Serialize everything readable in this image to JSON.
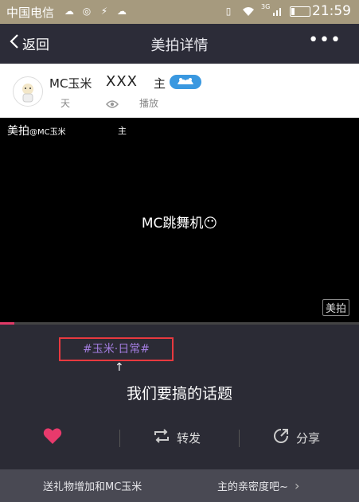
{
  "status_bar": {
    "carrier": "中国电信",
    "network_label": "3G",
    "time": "21:59"
  },
  "nav": {
    "back_label": "返回",
    "title": "美拍详情",
    "more_label": "•••"
  },
  "user": {
    "name": "MC玉米",
    "name_suffix": "XXX",
    "role": "主",
    "days_label": "天",
    "plays_label": "播放"
  },
  "video": {
    "brand": "美拍",
    "handle": "@MC玉米",
    "role": "主",
    "caption": "MC跳舞机",
    "emoji": "😶",
    "logo": "美拍",
    "progress": 0.04
  },
  "topic": {
    "tag": "#玉米·日常#",
    "arrow": "↑",
    "annotation": "我们要搞的话题"
  },
  "actions": {
    "like_label": "",
    "repost_label": "转发",
    "share_label": "分享"
  },
  "footer": {
    "left_text": "送礼物增加和MC玉米",
    "right_text": "主的亲密度吧~",
    "chevron": "›"
  },
  "colors": {
    "accent_pink": "#e83a6c",
    "topic_purple": "#a37de0",
    "highlight_red": "#e8393f",
    "status_bar": "#a69a7e"
  }
}
